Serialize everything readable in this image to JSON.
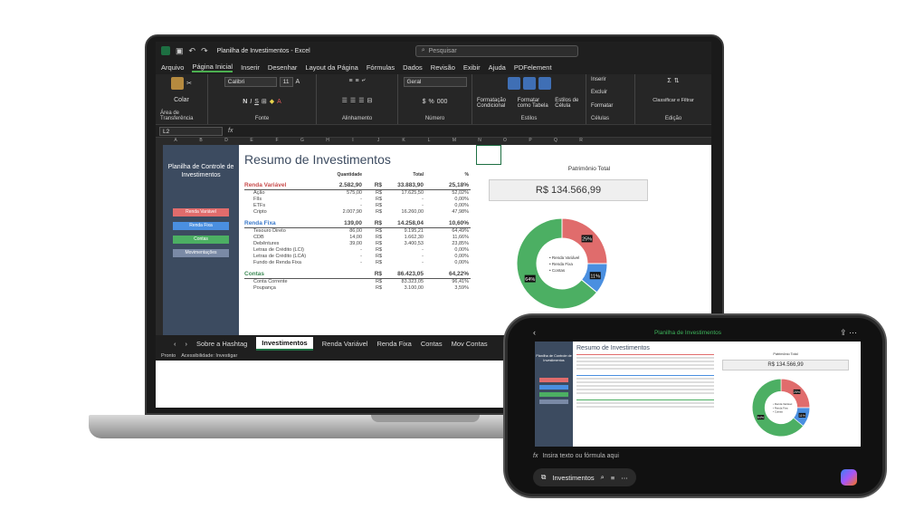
{
  "excel": {
    "window_title": "Planilha de Investimentos - Excel",
    "search_placeholder": "Pesquisar",
    "menu": [
      "Arquivo",
      "Página Inicial",
      "Inserir",
      "Desenhar",
      "Layout da Página",
      "Fórmulas",
      "Dados",
      "Revisão",
      "Exibir",
      "Ajuda",
      "PDFelement"
    ],
    "ribbon": {
      "paste": "Colar",
      "clipboard_group": "Área de Transferência",
      "font_name": "Calibri",
      "font_size": "11",
      "font_group": "Fonte",
      "alignment_group": "Alinhamento",
      "number_format": "Geral",
      "number_group": "Número",
      "cond_format": "Formatação Condicional",
      "format_table": "Formatar como Tabela",
      "cell_styles": "Estilos de Célula",
      "styles_group": "Estilos",
      "insert": "Inserir",
      "delete": "Excluir",
      "format": "Formatar",
      "cells_group": "Células",
      "sort_filter": "Classificar e Filtrar",
      "find_select": "Localizar e Selecionar",
      "editing_group": "Edição"
    },
    "name_box": "L2",
    "fx_label": "fx",
    "columns": [
      "A",
      "B",
      "D",
      "E",
      "F",
      "G",
      "H",
      "I",
      "J",
      "K",
      "L",
      "M",
      "N",
      "O",
      "P",
      "Q",
      "R"
    ],
    "tabs": [
      "Sobre a Hashtag",
      "Investimentos",
      "Renda Variável",
      "Renda Fixa",
      "Contas",
      "Mov Contas"
    ],
    "active_tab": "Investimentos",
    "status_left": "Pronto",
    "status_accessibility": "Acessibilidade: Investigar"
  },
  "dashboard": {
    "sidebar_title": "Planilha de Controle de Investimentos",
    "side_buttons": [
      {
        "label": "Renda Variável",
        "color": "#e06c6c"
      },
      {
        "label": "Renda Fixa",
        "color": "#4a8fe0"
      },
      {
        "label": "Contas",
        "color": "#4caf63"
      },
      {
        "label": "Movimentações",
        "color": "#7a8aa6"
      }
    ],
    "title": "Resumo de Investimentos",
    "headers": {
      "qty": "Quantidade",
      "total": "Total",
      "pct": "%"
    },
    "sections": [
      {
        "name": "Renda Variável",
        "qty": "2.582,90",
        "cur": "R$",
        "total": "33.883,90",
        "pct": "25,18%",
        "rows": [
          {
            "name": "Ação",
            "qty": "575,00",
            "cur": "R$",
            "total": "17.625,50",
            "pct": "52,02%"
          },
          {
            "name": "FIIs",
            "qty": "-",
            "cur": "R$",
            "total": "-",
            "pct": "0,00%"
          },
          {
            "name": "ETFs",
            "qty": "-",
            "cur": "R$",
            "total": "-",
            "pct": "0,00%"
          },
          {
            "name": "Cripto",
            "qty": "2.007,90",
            "cur": "R$",
            "total": "16.260,00",
            "pct": "47,98%"
          }
        ]
      },
      {
        "name": "Renda Fixa",
        "qty": "139,00",
        "cur": "R$",
        "total": "14.258,04",
        "pct": "10,60%",
        "rows": [
          {
            "name": "Tesouro Direto",
            "qty": "86,00",
            "cur": "R$",
            "total": "9.195,21",
            "pct": "64,49%"
          },
          {
            "name": "CDB",
            "qty": "14,00",
            "cur": "R$",
            "total": "1.662,30",
            "pct": "11,66%"
          },
          {
            "name": "Debêntures",
            "qty": "39,00",
            "cur": "R$",
            "total": "3.400,53",
            "pct": "23,85%"
          },
          {
            "name": "Letras de Crédito (LCI)",
            "qty": "-",
            "cur": "R$",
            "total": "-",
            "pct": "0,00%"
          },
          {
            "name": "Letras de Crédito (LCA)",
            "qty": "-",
            "cur": "R$",
            "total": "-",
            "pct": "0,00%"
          },
          {
            "name": "Fundo de Renda Fixa",
            "qty": "-",
            "cur": "R$",
            "total": "-",
            "pct": "0,00%"
          }
        ]
      },
      {
        "name": "Contas",
        "qty": "",
        "cur": "R$",
        "total": "86.423,05",
        "pct": "64,22%",
        "rows": [
          {
            "name": "Conta Corrente",
            "qty": "",
            "cur": "R$",
            "total": "83.323,05",
            "pct": "96,41%"
          },
          {
            "name": "Poupança",
            "qty": "",
            "cur": "R$",
            "total": "3.100,00",
            "pct": "3,59%"
          }
        ]
      }
    ],
    "patrimonio_label": "Patrimônio Total",
    "patrimonio_value": "R$ 134.566,99"
  },
  "chart_data": {
    "type": "pie",
    "categories": [
      "Renda Variável",
      "Renda Fixa",
      "Contas"
    ],
    "values": [
      25,
      11,
      64
    ],
    "data_labels": [
      "25%",
      "11%",
      "64%"
    ],
    "colors": [
      "#e06c6c",
      "#4a8fe0",
      "#4caf63"
    ],
    "legend": "center"
  },
  "phone": {
    "title": "Planilha de Investimentos",
    "fx_placeholder": "Insira texto ou fórmula aqui",
    "sheet_name": "Investimentos"
  }
}
